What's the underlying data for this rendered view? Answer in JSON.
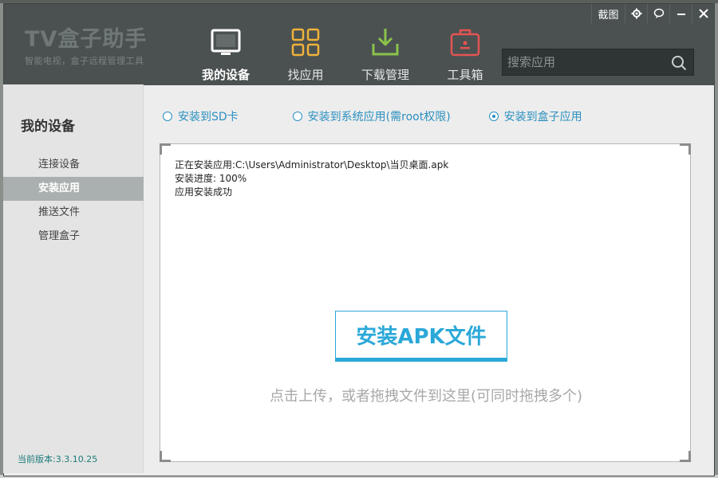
{
  "app": {
    "logo_title": "TV盒子助手",
    "logo_subtitle": "智能电视，盒子远程管理工具"
  },
  "window_controls": {
    "screenshot_label": "截图",
    "icons": [
      "gear-icon",
      "chat-icon",
      "minimize-icon",
      "close-icon"
    ]
  },
  "nav": {
    "items": [
      {
        "label": "我的设备",
        "icon": "tv-icon",
        "active": true
      },
      {
        "label": "找应用",
        "icon": "grid-icon",
        "active": false
      },
      {
        "label": "下载管理",
        "icon": "download-icon",
        "active": false
      },
      {
        "label": "工具箱",
        "icon": "toolbox-icon",
        "active": false
      }
    ]
  },
  "search": {
    "placeholder": "搜索应用",
    "icon": "search-icon"
  },
  "sidebar": {
    "title": "我的设备",
    "items": [
      {
        "label": "连接设备",
        "active": false
      },
      {
        "label": "安装应用",
        "active": true
      },
      {
        "label": "推送文件",
        "active": false
      },
      {
        "label": "管理盒子",
        "active": false
      }
    ],
    "version": "当前版本:3.3.10.25"
  },
  "install_options": [
    {
      "label": "安装到SD卡",
      "checked": false
    },
    {
      "label": "安装到系统应用(需root权限)",
      "checked": false
    },
    {
      "label": "安装到盒子应用",
      "checked": true
    }
  ],
  "install_log": {
    "line1": "正在安装应用:C:\\Users\\Administrator\\Desktop\\当贝桌面.apk",
    "line2": "安装进度:  100%",
    "line3": "应用安装成功"
  },
  "install_button": "安装APK文件",
  "hint": "点击上传，或者拖拽文件到这里(可同时拖拽多个)",
  "colors": {
    "header_bg": "#4b5151",
    "accent": "#2aa8d8",
    "option_text": "#2a8fbf",
    "download_icon": "#8bc34a",
    "grid_icon": "#f0b23a",
    "toolbox_icon": "#e35452"
  }
}
